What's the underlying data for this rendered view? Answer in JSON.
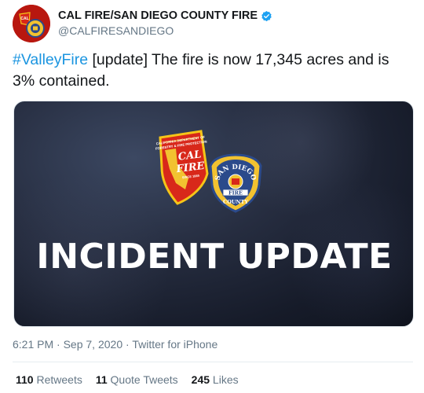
{
  "account": {
    "display_name": "CAL FIRE/SAN DIEGO COUNTY FIRE",
    "handle": "@CALFIRESANDIEGO",
    "verified_icon": "verified-badge-icon",
    "brand_color": "#1da1f2"
  },
  "tweet": {
    "hashtag": "#ValleyFire",
    "body": " [update] The fire is now 17,345 acres and is 3% contained.",
    "hashtag_color": "#1b95e0"
  },
  "media": {
    "title": "INCIDENT UPDATE",
    "logo_calfire": {
      "line1": "CALIFORNIA DEPARTMENT OF",
      "line2": "FORESTRY & FIRE PROTECTION",
      "word1": "CAL",
      "word2": "FIRE",
      "since": "SINCE 1885"
    },
    "logo_county": {
      "arc": "SAN DIEGO",
      "banner": "FIRE",
      "bottom": "COUNTY"
    }
  },
  "meta": {
    "time": "6:21 PM",
    "sep1": " · ",
    "date": "Sep 7, 2020",
    "sep2": " · ",
    "source": "Twitter for iPhone"
  },
  "stats": {
    "retweets_count": "110",
    "retweets_label": " Retweets",
    "quote_count": "11",
    "quote_label": " Quote Tweets",
    "likes_count": "245",
    "likes_label": " Likes"
  }
}
